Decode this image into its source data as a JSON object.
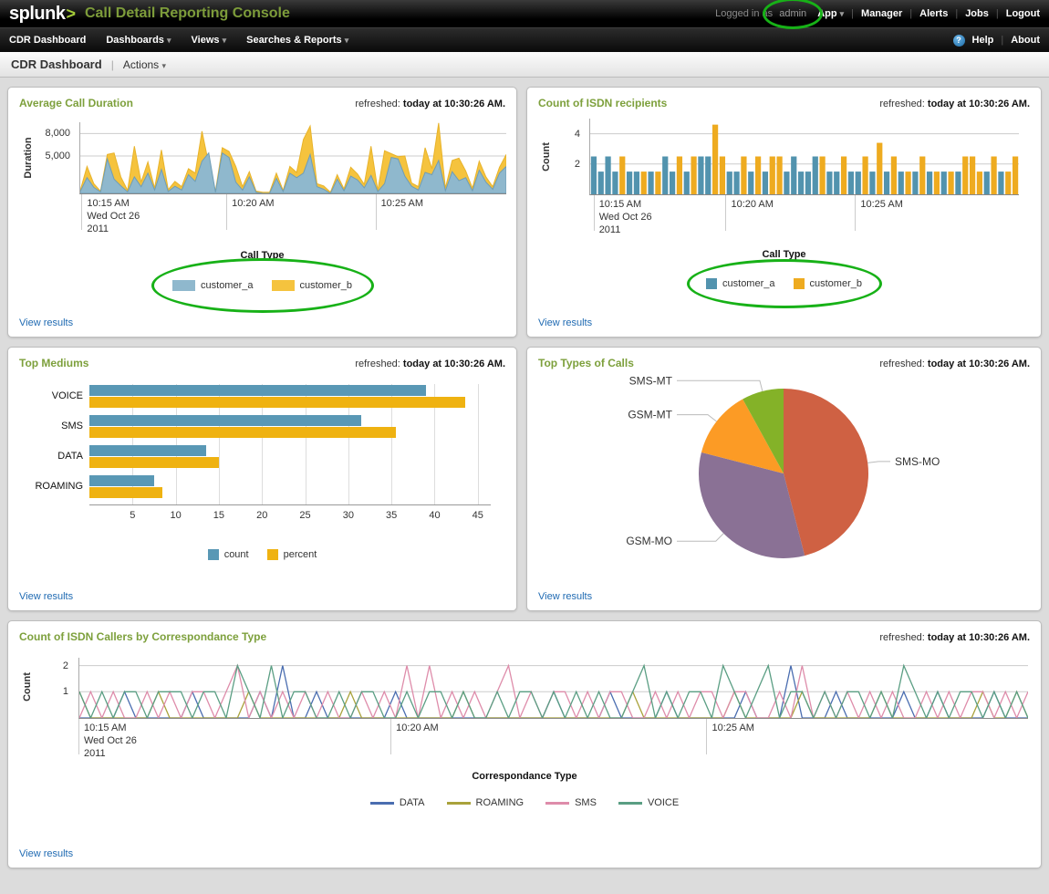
{
  "header": {
    "logo": "splunk",
    "logo_arrow": ">",
    "app_title": "Call Detail Reporting Console",
    "logged_in_prefix": "Logged in as",
    "logged_in_user": "admin",
    "app_menu": "App",
    "top_links": [
      "Manager",
      "Alerts",
      "Jobs",
      "Logout"
    ],
    "nav": [
      "CDR Dashboard",
      "Dashboards",
      "Views",
      "Searches & Reports"
    ],
    "help": "Help",
    "about": "About"
  },
  "breadcrumb": {
    "title": "CDR Dashboard",
    "actions": "Actions"
  },
  "labels": {
    "view_results": "View results",
    "refreshed_prefix": "refreshed:",
    "refreshed_time": "today at 10:30:26 AM."
  },
  "panels": {
    "p1": {
      "title": "Average Call Duration",
      "ylabel": "Duration",
      "yticks": [
        "8,000",
        "5,000"
      ],
      "xticks": [
        "10:15 AM",
        "10:20 AM",
        "10:25 AM"
      ],
      "xsub": [
        "Wed Oct 26",
        "2011"
      ],
      "legend_title": "Call Type"
    },
    "p2": {
      "title": "Count of ISDN recipients",
      "ylabel": "Count",
      "yticks": [
        "4",
        "2"
      ],
      "xticks": [
        "10:15 AM",
        "10:20 AM",
        "10:25 AM"
      ],
      "xsub": [
        "Wed Oct 26",
        "2011"
      ],
      "legend_title": "Call Type"
    },
    "p3": {
      "title": "Top Mediums"
    },
    "p4": {
      "title": "Top Types of Calls"
    },
    "p5": {
      "title": "Count of ISDN Callers by Correspondance Type",
      "ylabel": "Count",
      "yticks": [
        "2",
        "1"
      ],
      "xticks": [
        "10:15 AM",
        "10:20 AM",
        "10:25 AM"
      ],
      "xsub": [
        "Wed Oct 26",
        "2011"
      ],
      "legend_title": "Correspondance Type"
    }
  },
  "colors": {
    "title_green": "#7da03c",
    "annotation_green": "#17b117",
    "link_blue": "#1f6ab2",
    "grid": "#cccccc",
    "axis": "#888888"
  },
  "chart_data": [
    {
      "id": "avg_call_duration",
      "type": "area",
      "title": "Average Call Duration",
      "ylabel": "Duration",
      "yticks": [
        5000,
        8000
      ],
      "ymax": 9500,
      "xticks": [
        "10:15 AM Wed Oct 26 2011",
        "10:20 AM",
        "10:25 AM"
      ],
      "legend_title": "Call Type",
      "legend_position": "bottom",
      "series": [
        {
          "name": "customer_a",
          "color": "#8fb8cd",
          "stroke": "#6f9db5",
          "values": [
            250,
            2100,
            800,
            200,
            4600,
            1900,
            1000,
            200,
            2200,
            900,
            2700,
            450,
            3200,
            250,
            950,
            450,
            2500,
            1600,
            4300,
            5400,
            150,
            5400,
            4800,
            1500,
            450,
            2200,
            150,
            0,
            0,
            2000,
            250,
            2700,
            2100,
            2700,
            5200,
            900,
            550,
            0,
            1900,
            350,
            2300,
            1800,
            750,
            2400,
            250,
            1300,
            4800,
            4600,
            2300,
            950,
            450,
            2800,
            2500,
            4400,
            350,
            2900,
            1700,
            2100,
            350,
            3100,
            1500,
            550,
            2700,
            3600
          ]
        },
        {
          "name": "customer_b",
          "color": "#f5c33e",
          "stroke": "#e8b32a",
          "values": [
            400,
            3600,
            1300,
            300,
            5200,
            5400,
            2200,
            400,
            6300,
            1500,
            4200,
            700,
            5800,
            500,
            1600,
            900,
            3300,
            2700,
            8300,
            3900,
            300,
            6100,
            5600,
            3600,
            900,
            2900,
            300,
            150,
            150,
            2700,
            400,
            3600,
            2800,
            7200,
            9000,
            1300,
            1000,
            150,
            2500,
            600,
            3500,
            2600,
            1200,
            6300,
            400,
            5700,
            5300,
            4900,
            5000,
            1400,
            900,
            6100,
            3300,
            9400,
            700,
            4400,
            4700,
            3000,
            700,
            4300,
            2200,
            900,
            3500,
            5200
          ]
        }
      ]
    },
    {
      "id": "isdn_recipients",
      "type": "column",
      "title": "Count of ISDN recipients",
      "ylabel": "Count",
      "yticks": [
        2,
        4
      ],
      "ymax": 5,
      "xticks": [
        "10:15 AM Wed Oct 26 2011",
        "10:20 AM",
        "10:25 AM"
      ],
      "legend_title": "Call Type",
      "series_colors": {
        "a": "#5293ae",
        "b": "#eeab20"
      },
      "series_names": {
        "a": "customer_a",
        "b": "customer_b"
      },
      "bars": [
        [
          "a",
          2.5
        ],
        [
          "a",
          1.5
        ],
        [
          "a",
          2.5
        ],
        [
          "a",
          1.5
        ],
        [
          "b",
          2.5
        ],
        [
          "a",
          1.5
        ],
        [
          "a",
          1.5
        ],
        [
          "b",
          1.5
        ],
        [
          "a",
          1.5
        ],
        [
          "b",
          1.5
        ],
        [
          "a",
          2.5
        ],
        [
          "a",
          1.5
        ],
        [
          "b",
          2.5
        ],
        [
          "a",
          1.5
        ],
        [
          "b",
          2.5
        ],
        [
          "a",
          2.5
        ],
        [
          "a",
          2.5
        ],
        [
          "b",
          4.6
        ],
        [
          "b",
          2.5
        ],
        [
          "a",
          1.5
        ],
        [
          "a",
          1.5
        ],
        [
          "b",
          2.5
        ],
        [
          "a",
          1.5
        ],
        [
          "b",
          2.5
        ],
        [
          "a",
          1.5
        ],
        [
          "b",
          2.5
        ],
        [
          "b",
          2.5
        ],
        [
          "a",
          1.5
        ],
        [
          "a",
          2.5
        ],
        [
          "a",
          1.5
        ],
        [
          "a",
          1.5
        ],
        [
          "a",
          2.5
        ],
        [
          "b",
          2.5
        ],
        [
          "a",
          1.5
        ],
        [
          "a",
          1.5
        ],
        [
          "b",
          2.5
        ],
        [
          "a",
          1.5
        ],
        [
          "a",
          1.5
        ],
        [
          "b",
          2.5
        ],
        [
          "a",
          1.5
        ],
        [
          "b",
          3.4
        ],
        [
          "a",
          1.5
        ],
        [
          "b",
          2.5
        ],
        [
          "a",
          1.5
        ],
        [
          "b",
          1.5
        ],
        [
          "a",
          1.5
        ],
        [
          "b",
          2.5
        ],
        [
          "a",
          1.5
        ],
        [
          "b",
          1.5
        ],
        [
          "a",
          1.5
        ],
        [
          "b",
          1.5
        ],
        [
          "a",
          1.5
        ],
        [
          "b",
          2.5
        ],
        [
          "b",
          2.5
        ],
        [
          "b",
          1.5
        ],
        [
          "a",
          1.5
        ],
        [
          "b",
          2.5
        ],
        [
          "a",
          1.5
        ],
        [
          "b",
          1.5
        ],
        [
          "b",
          2.5
        ]
      ]
    },
    {
      "id": "top_mediums",
      "type": "hbar",
      "title": "Top Mediums",
      "categories": [
        "VOICE",
        "SMS",
        "DATA",
        "ROAMING"
      ],
      "series": [
        {
          "name": "count",
          "color": "#5998b5",
          "values": [
            39,
            31.5,
            13.5,
            7.5
          ]
        },
        {
          "name": "percent",
          "color": "#efb211",
          "values": [
            43.5,
            35.5,
            15,
            8.5
          ]
        }
      ],
      "xticks": [
        5,
        10,
        15,
        20,
        25,
        30,
        35,
        40,
        45
      ],
      "xmax": 46.5
    },
    {
      "id": "top_types_of_calls",
      "type": "pie",
      "title": "Top Types of Calls",
      "slices": [
        {
          "label": "SMS-MO",
          "value": 46,
          "color": "#cf6143"
        },
        {
          "label": "GSM-MO",
          "value": 33,
          "color": "#8a7195"
        },
        {
          "label": "GSM-MT",
          "value": 13,
          "color": "#fc9b25"
        },
        {
          "label": "SMS-MT",
          "value": 8,
          "color": "#84b228"
        }
      ],
      "start": "top",
      "direction": "clockwise"
    },
    {
      "id": "isdn_callers_by_type",
      "type": "line",
      "title": "Count of ISDN Callers by Correspondance Type",
      "ylabel": "Count",
      "yticks": [
        1,
        2
      ],
      "ymax": 2.3,
      "xticks": [
        "10:15 AM Wed Oct 26 2011",
        "10:20 AM",
        "10:25 AM"
      ],
      "legend_title": "Correspondance Type",
      "series": [
        {
          "name": "DATA",
          "color": "#4a6db0",
          "values": [
            0,
            0,
            0,
            0,
            1,
            0,
            0,
            0,
            0,
            0,
            1,
            0,
            0,
            0,
            0,
            0,
            1,
            0,
            2,
            0,
            0,
            1,
            0,
            0,
            0,
            0,
            0,
            0,
            1,
            0,
            0,
            0,
            0,
            0,
            0,
            0,
            0,
            0,
            0,
            0,
            0,
            0,
            1,
            0,
            0,
            0,
            0,
            1,
            0,
            0,
            0,
            0,
            1,
            0,
            0,
            0,
            0,
            0,
            0,
            1,
            0,
            0,
            0,
            2,
            0,
            0,
            0,
            1,
            0,
            0,
            0,
            0,
            0,
            1,
            0,
            0,
            1,
            0,
            0,
            0,
            0,
            1,
            0,
            0,
            0
          ]
        },
        {
          "name": "ROAMING",
          "color": "#a9a23b",
          "values": [
            1,
            0,
            0,
            0,
            0,
            0,
            0,
            1,
            0,
            0,
            0,
            0,
            0,
            0,
            0,
            1,
            0,
            0,
            0,
            0,
            0,
            0,
            0,
            0,
            1,
            0,
            0,
            0,
            0,
            0,
            0,
            0,
            0,
            0,
            1,
            0,
            0,
            0,
            0,
            0,
            0,
            0,
            0,
            0,
            0,
            0,
            0,
            0,
            0,
            1,
            0,
            0,
            0,
            0,
            0,
            0,
            0,
            0,
            1,
            0,
            0,
            0,
            0,
            0,
            1,
            0,
            0,
            0,
            0,
            0,
            0,
            1,
            0,
            0,
            0,
            0,
            0,
            0,
            0,
            0,
            1,
            0,
            0,
            1,
            0
          ]
        },
        {
          "name": "SMS",
          "color": "#de8caa",
          "values": [
            0,
            1,
            0,
            1,
            0,
            0,
            1,
            0,
            1,
            0,
            1,
            1,
            0,
            1,
            2,
            0,
            1,
            0,
            1,
            0,
            1,
            0,
            1,
            0,
            0,
            1,
            0,
            1,
            0,
            2,
            0,
            2,
            0,
            1,
            0,
            1,
            0,
            1,
            2,
            0,
            1,
            0,
            1,
            1,
            0,
            1,
            0,
            1,
            1,
            0,
            0,
            1,
            0,
            1,
            0,
            1,
            1,
            0,
            1,
            1,
            0,
            0,
            1,
            0,
            2,
            0,
            1,
            0,
            1,
            0,
            1,
            0,
            1,
            0,
            0,
            1,
            0,
            1,
            0,
            1,
            1,
            0,
            1,
            0,
            1
          ]
        },
        {
          "name": "VOICE",
          "color": "#5a9e83",
          "values": [
            1,
            0,
            1,
            0,
            1,
            1,
            0,
            1,
            1,
            1,
            0,
            1,
            1,
            0,
            2,
            1,
            0,
            2,
            0,
            1,
            1,
            0,
            0,
            1,
            0,
            1,
            1,
            0,
            0,
            1,
            0,
            1,
            1,
            0,
            1,
            0,
            0,
            1,
            0,
            1,
            1,
            0,
            1,
            0,
            1,
            0,
            1,
            0,
            0,
            1,
            2,
            0,
            1,
            0,
            1,
            1,
            0,
            2,
            1,
            0,
            1,
            2,
            0,
            1,
            1,
            0,
            1,
            0,
            1,
            1,
            0,
            1,
            0,
            2,
            1,
            0,
            1,
            0,
            1,
            1,
            0,
            1,
            0,
            1,
            0
          ]
        }
      ]
    }
  ]
}
